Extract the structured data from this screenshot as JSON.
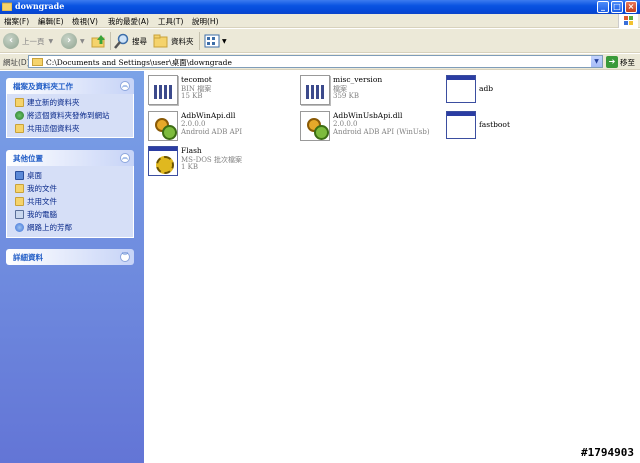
{
  "window": {
    "title": "downgrade"
  },
  "menu": [
    "檔案(F)",
    "編輯(E)",
    "檢視(V)",
    "我的最愛(A)",
    "工具(T)",
    "說明(H)"
  ],
  "toolbar": {
    "back_label": "上一頁",
    "search_label": "搜尋",
    "folders_label": "資料夾"
  },
  "address": {
    "label": "網址(D)",
    "path": "C:\\Documents and Settings\\user\\桌面\\downgrade",
    "go_label": "移至"
  },
  "left": {
    "tasks": {
      "title": "檔案及資料夾工作",
      "items": [
        "建立新的資料夾",
        "將這個資料夾發佈到網站",
        "共用這個資料夾"
      ]
    },
    "places": {
      "title": "其他位置",
      "items": [
        "桌面",
        "我的文件",
        "共用文件",
        "我的電腦",
        "網路上的芳鄰"
      ]
    },
    "details": {
      "title": "詳細資料"
    }
  },
  "files": [
    {
      "name": "tecomot",
      "line1": "BIN 檔案",
      "line2": "15 KB",
      "icon": "bin-file-icon"
    },
    {
      "name": "misc_version",
      "line1": "檔案",
      "line2": "359 KB",
      "icon": "bin-file-icon"
    },
    {
      "name": "adb",
      "line1": "",
      "line2": "",
      "icon": "exe-window-icon"
    },
    {
      "name": "AdbWinApi.dll",
      "line1": "2.0.0.0",
      "line2": "Android ADB API",
      "icon": "dll-gears-icon"
    },
    {
      "name": "AdbWinUsbApi.dll",
      "line1": "2.0.0.0",
      "line2": "Android ADB API (WinUsb)",
      "icon": "dll-gears-icon"
    },
    {
      "name": "fastboot",
      "line1": "",
      "line2": "",
      "icon": "exe-window-icon"
    },
    {
      "name": "Flash",
      "line1": "MS-DOS 批次檔案",
      "line2": "1 KB",
      "icon": "batch-file-icon"
    }
  ],
  "watermark": "#1794903"
}
